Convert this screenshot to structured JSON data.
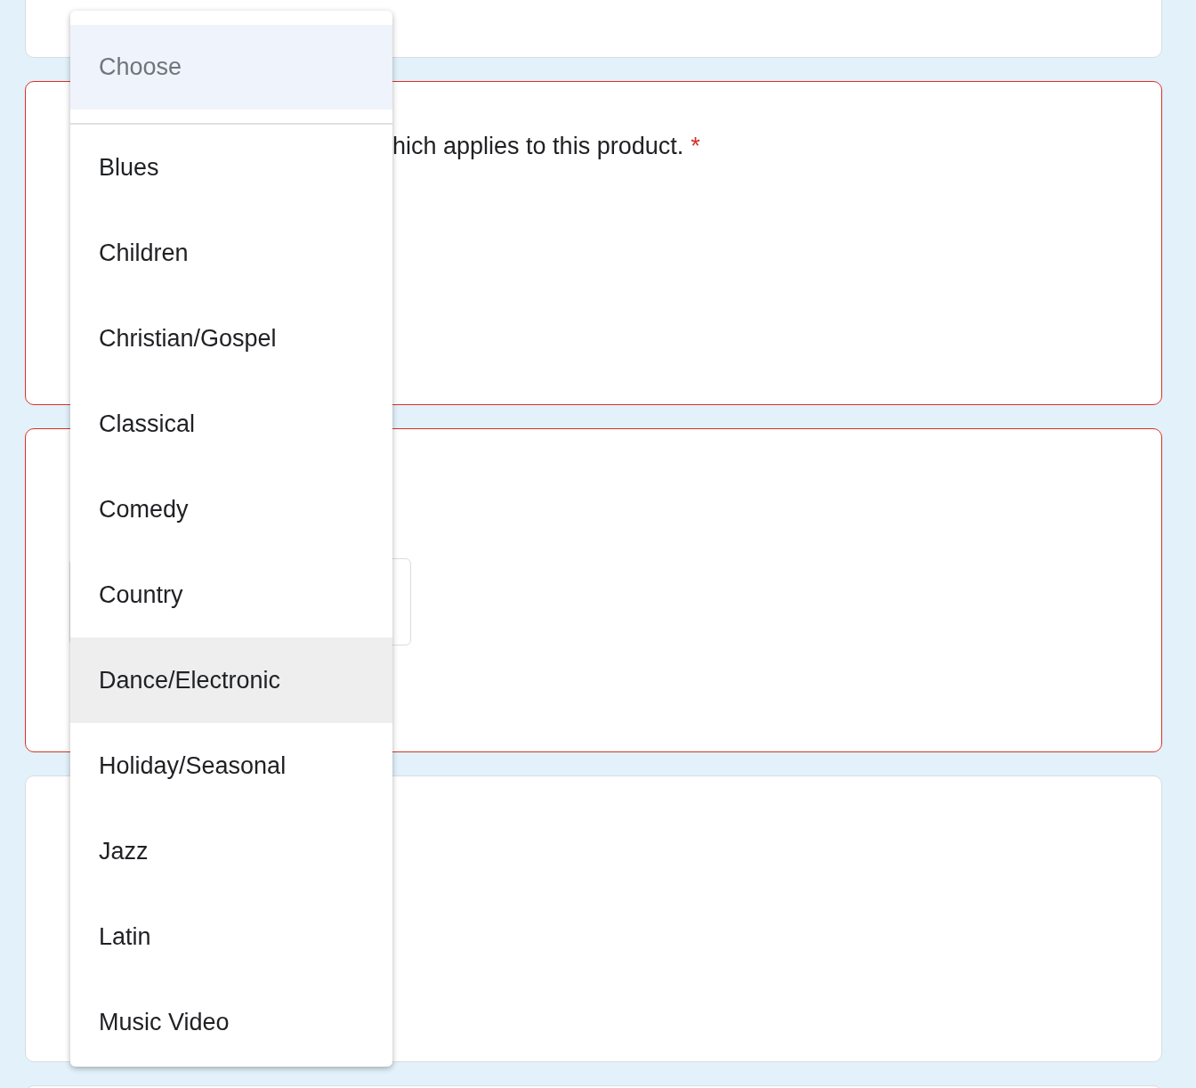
{
  "question": {
    "text": "hich applies to this product.",
    "required_mark": "*"
  },
  "dropdown": {
    "placeholder": "Choose",
    "options": [
      {
        "label": "Blues",
        "selected": false
      },
      {
        "label": "Children",
        "selected": false
      },
      {
        "label": "Christian/Gospel",
        "selected": false
      },
      {
        "label": "Classical",
        "selected": false
      },
      {
        "label": "Comedy",
        "selected": false
      },
      {
        "label": "Country",
        "selected": false
      },
      {
        "label": "Dance/Electronic",
        "selected": true
      },
      {
        "label": "Holiday/Seasonal",
        "selected": false
      },
      {
        "label": "Jazz",
        "selected": false
      },
      {
        "label": "Latin",
        "selected": false
      },
      {
        "label": "Music Video",
        "selected": false
      }
    ]
  }
}
